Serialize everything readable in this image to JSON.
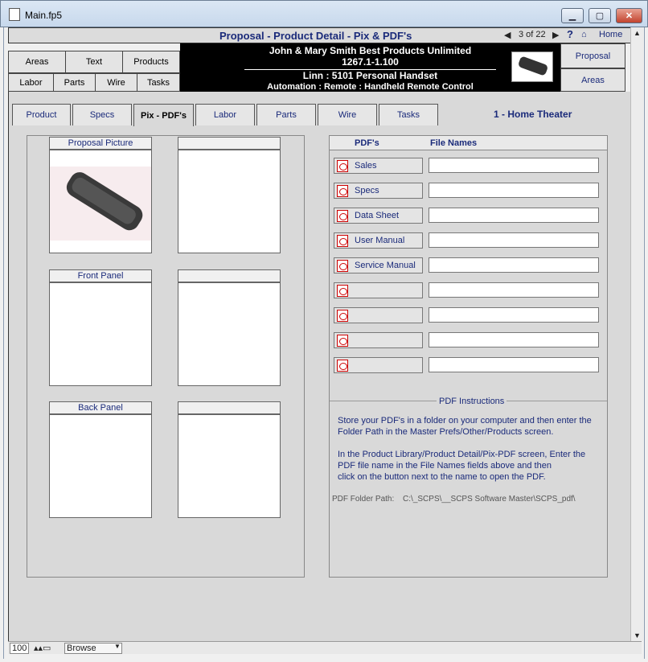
{
  "window": {
    "title": "Main.fp5"
  },
  "header": {
    "title": "Proposal - Product Detail - Pix & PDF's",
    "counter": "3 of 22",
    "help": "?",
    "home": "Home"
  },
  "leftnav": {
    "row1": [
      "Areas",
      "Text",
      "Products"
    ],
    "row2": [
      "Labor",
      "Parts",
      "Wire",
      "Tasks"
    ]
  },
  "banner": {
    "line1": "John & Mary Smith  Best Products Unlimited",
    "line2": "1267.1-1.100",
    "line3": "Linn : 5101 Personal Handset",
    "line4": "Automation : Remote : Handheld Remote Control"
  },
  "rightnav": {
    "proposal": "Proposal",
    "areas": "Areas"
  },
  "tabs": [
    "Product",
    "Specs",
    "Pix - PDF's",
    "Labor",
    "Parts",
    "Wire",
    "Tasks"
  ],
  "room": "1 - Home Theater",
  "pictures": {
    "proposal": "Proposal Picture",
    "front": "Front Panel",
    "back": "Back Panel"
  },
  "pdfs": {
    "col1": "PDF's",
    "col2": "File Names",
    "items": [
      "Sales",
      "Specs",
      "Data Sheet",
      "User Manual",
      "Service Manual",
      "",
      "",
      "",
      ""
    ],
    "files": [
      "",
      "",
      "",
      "",
      "",
      "",
      "",
      "",
      ""
    ]
  },
  "instructions": {
    "heading": "PDF Instructions",
    "p1a": "Store your PDF's in a folder on your computer and then enter the",
    "p1b": "Folder Path in the Master Prefs/Other/Products screen.",
    "p2a": "In the Product Library/Product Detail/Pix-PDF screen, Enter the",
    "p2b": "PDF file name in the File Names fields above and then",
    "p2c": "click on the button next to the name to open the PDF.",
    "pathlabel": "PDF Folder Path:",
    "pathvalue": "C:\\_SCPS\\__SCPS Software Master\\SCPS_pdf\\"
  },
  "status": {
    "zoom": "100",
    "mode": "Browse"
  }
}
